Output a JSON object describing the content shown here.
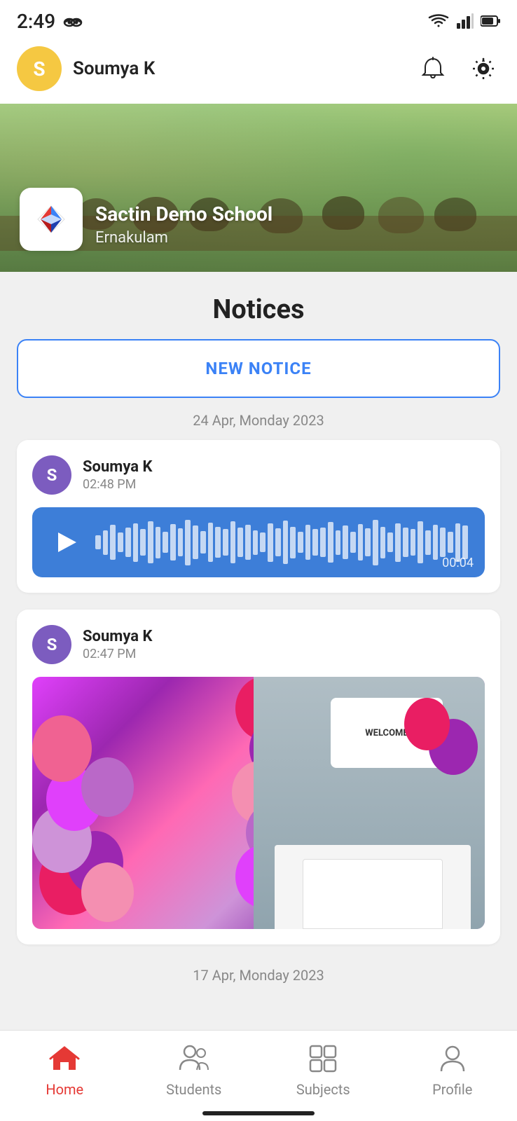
{
  "statusBar": {
    "time": "2:49",
    "icons": [
      "spy-icon",
      "wifi-icon",
      "signal-icon",
      "battery-icon"
    ]
  },
  "header": {
    "userInitial": "S",
    "userName": "Soumya K",
    "bellIcon": "bell-icon",
    "settingsIcon": "settings-icon"
  },
  "schoolBanner": {
    "name": "Sactin Demo School",
    "location": "Ernakulam"
  },
  "notices": {
    "title": "Notices",
    "newNoticeLabel": "NEW NOTICE",
    "dateSeparator1": "24 Apr, Monday 2023",
    "notice1": {
      "userName": "Soumya K",
      "userInitial": "S",
      "time": "02:48 PM",
      "type": "audio",
      "duration": "00:04"
    },
    "notice2": {
      "userName": "Soumya K",
      "userInitial": "S",
      "time": "02:47 PM",
      "type": "image"
    },
    "dateSeparator2": "17 Apr, Monday 2023"
  },
  "bottomNav": {
    "items": [
      {
        "id": "home",
        "label": "Home",
        "active": true
      },
      {
        "id": "students",
        "label": "Students",
        "active": false
      },
      {
        "id": "subjects",
        "label": "Subjects",
        "active": false
      },
      {
        "id": "profile",
        "label": "Profile",
        "active": false
      }
    ]
  },
  "waveBarHeights": [
    20,
    35,
    50,
    28,
    42,
    55,
    38,
    60,
    45,
    30,
    52,
    40,
    65,
    48,
    32,
    56,
    44,
    38,
    60,
    42,
    50,
    35,
    28,
    55,
    40,
    62,
    45,
    30,
    50,
    38,
    42,
    58,
    35,
    48,
    30,
    52,
    40,
    65,
    45,
    28,
    55,
    42,
    38,
    60,
    35,
    50,
    42,
    30,
    55,
    48
  ]
}
